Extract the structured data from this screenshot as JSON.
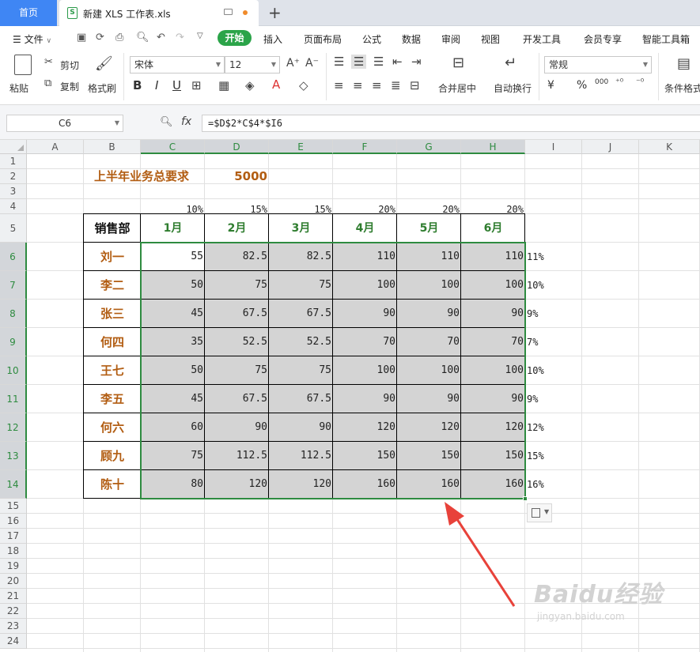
{
  "tabs": {
    "home": "首页",
    "file": "新建 XLS 工作表.xls",
    "file_badge": "S",
    "add": "+"
  },
  "menubar": {
    "file_menu": "文件",
    "active": "开始",
    "items": [
      "插入",
      "页面布局",
      "公式",
      "数据",
      "审阅",
      "视图",
      "开发工具",
      "会员专享",
      "智能工具箱"
    ]
  },
  "ribbon": {
    "paste": "粘贴",
    "cut": "剪切",
    "copy": "复制",
    "format_painter": "格式刷",
    "font_name": "宋体",
    "font_size": "12",
    "merge_center": "合并居中",
    "wrap_text": "自动换行",
    "number_format": "常规",
    "conditional_format": "条件格式",
    "bold": "B",
    "italic": "I",
    "underline": "U",
    "currency": "¥",
    "percent": "%",
    "thousands": "000"
  },
  "formula_bar": {
    "cell_ref": "C6",
    "fx": "fx",
    "formula": "=$D$2*C$4*$I6"
  },
  "sheet": {
    "columns": [
      "A",
      "B",
      "C",
      "D",
      "E",
      "F",
      "G",
      "H",
      "I",
      "J",
      "K"
    ],
    "rows": [
      "1",
      "2",
      "3",
      "4",
      "5",
      "6",
      "7",
      "8",
      "9",
      "10",
      "11",
      "12",
      "13",
      "14",
      "15",
      "16",
      "17",
      "18",
      "19",
      "20",
      "21",
      "22",
      "23",
      "24"
    ],
    "title": "上半年业务总要求",
    "total": "5000",
    "percents": [
      "10%",
      "15%",
      "15%",
      "20%",
      "20%",
      "20%"
    ],
    "dept_header": "销售部",
    "months": [
      "1月",
      "2月",
      "3月",
      "4月",
      "5月",
      "6月"
    ],
    "people": [
      {
        "name": "刘一",
        "values": [
          "55",
          "82.5",
          "82.5",
          "110",
          "110",
          "110"
        ],
        "ratio": "11%"
      },
      {
        "name": "李二",
        "values": [
          "50",
          "75",
          "75",
          "100",
          "100",
          "100"
        ],
        "ratio": "10%"
      },
      {
        "name": "张三",
        "values": [
          "45",
          "67.5",
          "67.5",
          "90",
          "90",
          "90"
        ],
        "ratio": "9%"
      },
      {
        "name": "何四",
        "values": [
          "35",
          "52.5",
          "52.5",
          "70",
          "70",
          "70"
        ],
        "ratio": "7%"
      },
      {
        "name": "王七",
        "values": [
          "50",
          "75",
          "75",
          "100",
          "100",
          "100"
        ],
        "ratio": "10%"
      },
      {
        "name": "李五",
        "values": [
          "45",
          "67.5",
          "67.5",
          "90",
          "90",
          "90"
        ],
        "ratio": "9%"
      },
      {
        "name": "何六",
        "values": [
          "60",
          "90",
          "90",
          "120",
          "120",
          "120"
        ],
        "ratio": "12%"
      },
      {
        "name": "顾九",
        "values": [
          "75",
          "112.5",
          "112.5",
          "150",
          "150",
          "150"
        ],
        "ratio": "15%"
      },
      {
        "name": "陈十",
        "values": [
          "80",
          "120",
          "120",
          "160",
          "160",
          "160"
        ],
        "ratio": "16%"
      }
    ]
  },
  "annotation": {
    "color": "#e8423a"
  },
  "watermark": {
    "logo": "Baidu经验",
    "url": "jingyan.baidu.com"
  },
  "colors": {
    "accent": "#2ba449",
    "selection": "#2e8b40",
    "name_text": "#b25d12",
    "home_tab": "#3f86f4"
  }
}
